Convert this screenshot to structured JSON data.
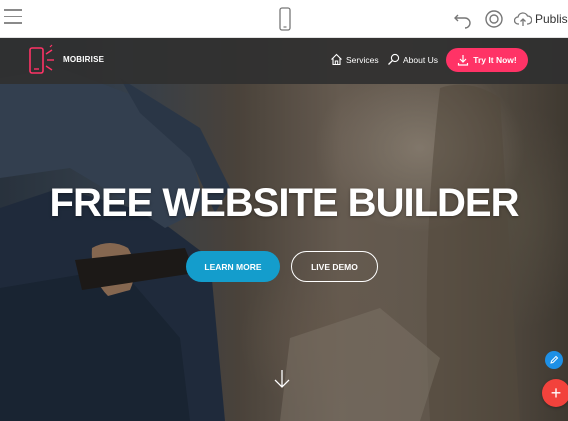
{
  "editor": {
    "publish_label": "Publish",
    "icons": [
      "hamburger-icon",
      "mobile-device-icon",
      "undo-icon",
      "preview-eye-icon",
      "cloud-upload-icon"
    ]
  },
  "site": {
    "brand": "MOBIRISE",
    "nav": {
      "services": "Services",
      "about": "About Us",
      "cta": "Try It Now!"
    },
    "hero": {
      "title": "FREE WEBSITE BUILDER",
      "primary_button": "LEARN MORE",
      "secondary_button": "LIVE DEMO"
    }
  },
  "floating": {
    "add_symbol": "+"
  },
  "colors": {
    "accent_pink": "#ff3366",
    "primary_blue": "#149dcc",
    "fab_blue": "#1e90e6",
    "fab_red": "#f2423c",
    "nav_bg": "#303030"
  }
}
